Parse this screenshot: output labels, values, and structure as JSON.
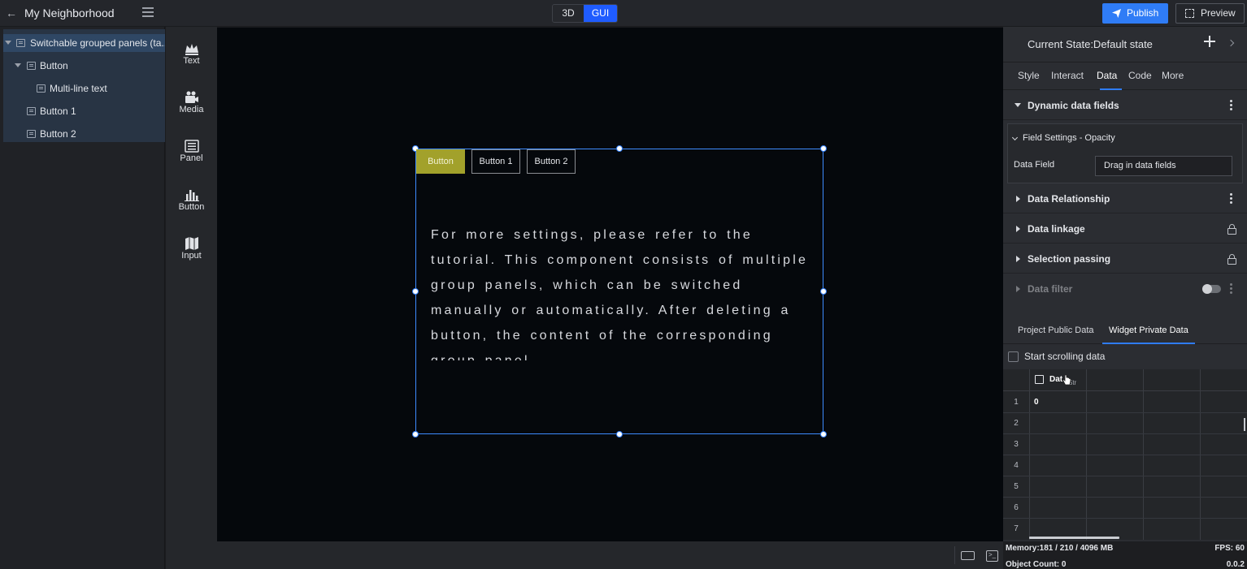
{
  "header": {
    "project_title": "My Neighborhood",
    "mode_3d": "3D",
    "mode_gui": "GUI",
    "publish_label": "Publish",
    "preview_label": "Preview"
  },
  "layers": {
    "items": [
      {
        "label": "Switchable grouped panels (ta..."
      },
      {
        "label": "Button"
      },
      {
        "label": "Multi-line text"
      },
      {
        "label": "Button 1"
      },
      {
        "label": "Button 2"
      }
    ]
  },
  "widgets": {
    "items": [
      {
        "label": "Text",
        "icon": "crown-icon"
      },
      {
        "label": "Media",
        "icon": "media-icon"
      },
      {
        "label": "Panel",
        "icon": "panel-icon"
      },
      {
        "label": "Button",
        "icon": "chart-icon"
      },
      {
        "label": "Input",
        "icon": "map-icon"
      }
    ]
  },
  "canvas": {
    "tab_buttons": [
      "Button",
      "Button 1",
      "Button 2"
    ],
    "panel_text": "For more settings, please refer to the tutorial. This component consists of multiple group panels, which can be switched manually or automatically. After deleting a button, the content of the corresponding group panel"
  },
  "right_panel": {
    "state_label": "Current State:Default state",
    "tabs": [
      "Style",
      "Interact",
      "Data",
      "Code",
      "More"
    ],
    "active_tab": "Data",
    "sections": {
      "dynamic_fields": "Dynamic data fields",
      "field_settings": "Field Settings - Opacity",
      "data_field_label": "Data Field",
      "data_field_placeholder": "Drag in data fields",
      "data_relationship": "Data Relationship",
      "data_linkage": "Data linkage",
      "selection_passing": "Selection passing",
      "data_filter": "Data filter"
    },
    "data_tabs": [
      "Project Public Data",
      "Widget Private Data"
    ],
    "scroll_label": "Start scrolling data",
    "grid": {
      "header": "Dat",
      "header_sub": "Str",
      "rows": [
        "1",
        "2",
        "3",
        "4",
        "5",
        "6",
        "7"
      ],
      "first_cell": "0"
    }
  },
  "status": {
    "memory": "Memory:181 / 210 / 4096 MB",
    "object_count": "Object Count: 0",
    "fps": "FPS: 60",
    "version": "0.0.2"
  },
  "colors": {
    "accent": "#2f7cf6",
    "active_button": "#a2a12b",
    "canvas_bg": "#05080c"
  }
}
